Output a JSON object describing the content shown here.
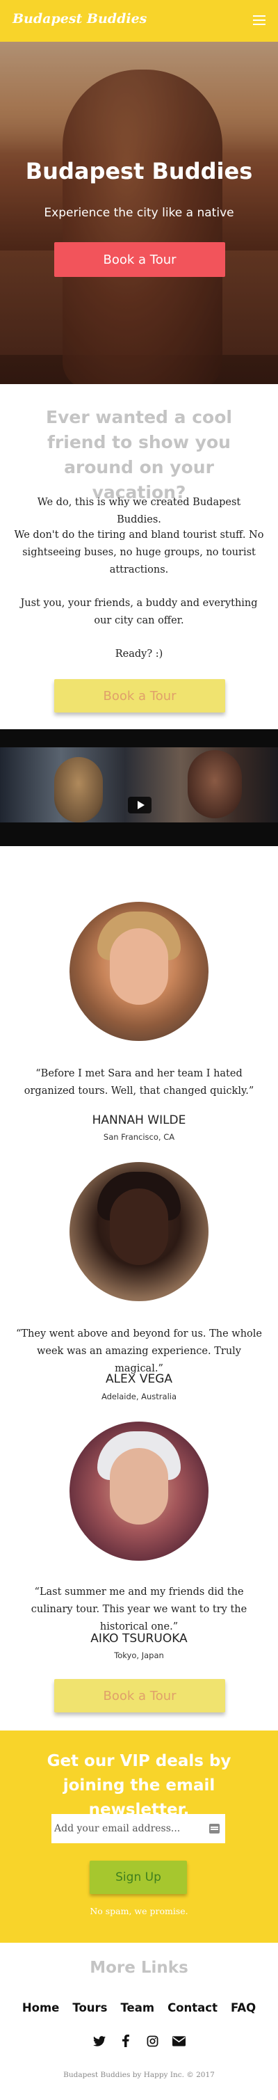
{
  "header": {
    "logo": "Budapest Buddies",
    "menu_icon": "hamburger-menu-icon"
  },
  "hero": {
    "title": "Budapest Buddies",
    "subtitle": "Experience the city like a native",
    "cta_label": "Book a Tour",
    "cta_color": "#f2545b"
  },
  "intro": {
    "title": "Ever wanted a cool friend to show you around on your vacation?",
    "p1": "We do, this is why we created Budapest Buddies.",
    "p2": "We don't do the tiring and bland tourist stuff. No sightseeing buses, no huge groups, no tourist attractions.",
    "p3": "Just you, your friends, a buddy and everything our city can offer.",
    "p4": "Ready? :)",
    "cta_label": "Book a Tour"
  },
  "video": {
    "play_icon": "play-icon"
  },
  "testimonials": [
    {
      "quote": "“Before I met Sara and her team I hated organized tours. Well, that changed quickly.”",
      "name": "HANNAH WILDE",
      "location": "San Francisco, CA"
    },
    {
      "quote": "“They went above and beyond for us. The whole week was an amazing experience. Truly magical.”",
      "name": "ALEX VEGA",
      "location": "Adelaide, Australia"
    },
    {
      "quote": "“Last summer me and my friends did the culinary tour. This year we want to try the historical one.”",
      "name": "AIKO TSURUOKA",
      "location": "Tokyo, Japan"
    }
  ],
  "testimonials_cta": "Book a Tour",
  "newsletter": {
    "title": "Get our VIP deals by joining the email newsletter.",
    "email_placeholder": "Add your email address...",
    "signup_label": "Sign Up",
    "note": "No spam, we promise.",
    "bg_color": "#f8d42a"
  },
  "more_links": {
    "title": "More Links",
    "nav": [
      "Home",
      "Tours",
      "Team",
      "Contact",
      "FAQ"
    ],
    "social_icons": [
      "twitter-icon",
      "facebook-icon",
      "instagram-icon",
      "email-icon"
    ]
  },
  "footer": "Budapest Buddies by Happy Inc. © 2017"
}
